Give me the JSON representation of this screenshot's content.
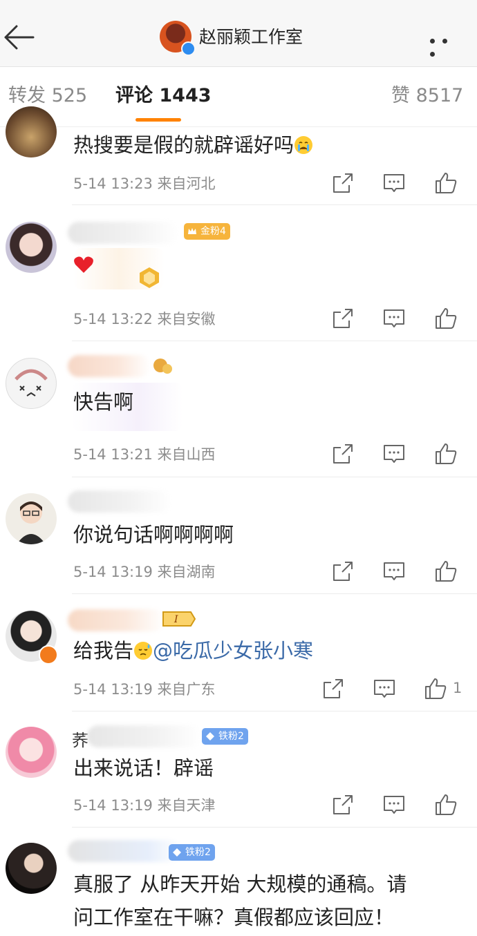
{
  "header": {
    "title": "赵丽颖工作室",
    "back_icon": "arrow-left-icon",
    "more_icon": "more-dots-icon"
  },
  "tabs": [
    {
      "label": "转发 525"
    },
    {
      "label": "评论 1443",
      "active": true
    },
    {
      "label": "赞 8517"
    }
  ],
  "colors": {
    "accent": "#ff8200",
    "mention": "#3b6aa8",
    "gold_badge": "#f6b43c",
    "iron_badge": "#6fa3ee"
  },
  "comments": [
    {
      "text": "热搜要是假的就辟谣好吗",
      "emoji": "crying-emoji",
      "meta": "5-14 13:23 来自河北"
    },
    {
      "badge": "金粉4",
      "meta": "5-14 13:22 来自安徽"
    },
    {
      "text": "快告啊",
      "meta": "5-14 13:21 来自山西"
    },
    {
      "text": "你说句话啊啊啊啊",
      "meta": "5-14 13:19 来自湖南"
    },
    {
      "text": "给我告",
      "emoji": "sweat-emoji",
      "mention": "@吃瓜少女张小寒",
      "meta": "5-14 13:19 来自广东",
      "likes": "1"
    },
    {
      "name_prefix": "荞",
      "badge": "铁粉2",
      "text": "出来说话！辟谣",
      "meta": "5-14 13:19 来自天津"
    },
    {
      "badge": "铁粉2",
      "text_line1": "真服了 从昨天开始 大规模的通稿。请",
      "text_line2": "问工作室在干嘛？真假都应该回应！"
    }
  ]
}
